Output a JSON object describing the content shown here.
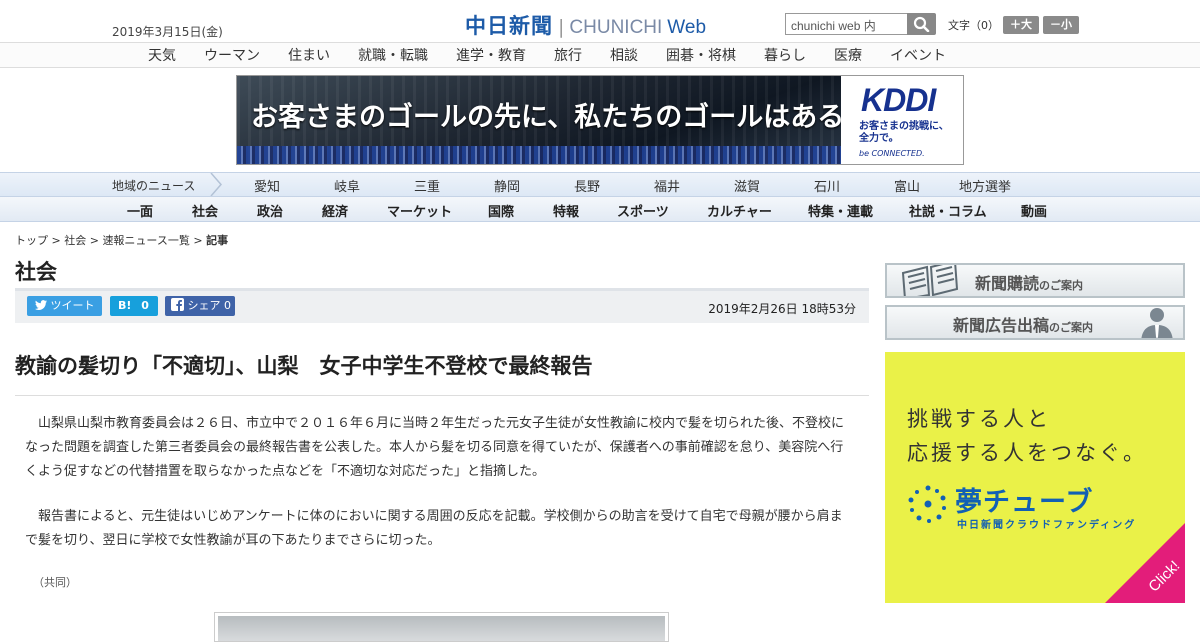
{
  "header": {
    "date": "2019年3月15日(金)",
    "logo_ja": "中日新聞",
    "logo_en": "CHUNICHI",
    "logo_web": "Web",
    "search_placeholder": "chunichi web 内",
    "text_size_label": "文字（0）",
    "text_size_up": "＋大",
    "text_size_down": "－小"
  },
  "topic_nav": [
    "天気",
    "ウーマン",
    "住まい",
    "就職・転職",
    "進学・教育",
    "旅行",
    "相談",
    "囲碁・将棋",
    "暮らし",
    "医療",
    "イベント"
  ],
  "ad": {
    "copy": "お客さまのゴールの先に、私たちのゴールはある。",
    "brand": "KDDI",
    "brand_sub_1": "お客さまの挑戦に、",
    "brand_sub_2": "全力で。",
    "tagline": "be CONNECTED."
  },
  "region_nav": {
    "label": "地域のニュース",
    "items": [
      "愛知",
      "岐阜",
      "三重",
      "静岡",
      "長野",
      "福井",
      "滋賀",
      "石川",
      "富山",
      "地方選挙"
    ]
  },
  "main_nav": [
    "一面",
    "社会",
    "政治",
    "経済",
    "マーケット",
    "国際",
    "特報",
    "スポーツ",
    "カルチャー",
    "特集・連載",
    "社説・コラム",
    "動画"
  ],
  "breadcrumb": {
    "items": [
      "トップ",
      "社会",
      "速報ニュース一覧"
    ],
    "separator": ">",
    "current": "記事"
  },
  "section_title": "社会",
  "share": {
    "tweet_label": "ツイート",
    "hatena_label": "B!",
    "hatena_count": "0",
    "facebook_label": "シェア",
    "facebook_count": "0",
    "published": "2019年2月26日 18時53分"
  },
  "article": {
    "headline": "教諭の髪切り「不適切」、山梨　女子中学生不登校で最終報告",
    "paragraphs": [
      "山梨県山梨市教育委員会は２６日、市立中で２０１６年６月に当時２年生だった元女子生徒が女性教諭に校内で髪を切られた後、不登校になった問題を調査した第三者委員会の最終報告書を公表した。本人から髪を切る同意を得ていたが、保護者への事前確認を怠り、美容院へ行くよう促すなどの代替措置を取らなかった点などを「不適切な対応だった」と指摘した。",
      "報告書によると、元生徒はいじめアンケートに体のにおいに関する周囲の反応を記載。学校側からの助言を受けて自宅で母親が腰から肩まで髪を切り、翌日に学校で女性教諭が耳の下あたりまでさらに切った。"
    ],
    "credit": "（共同）"
  },
  "sidebar": {
    "subscribe_main": "新聞購読",
    "subscribe_sub": "のご案内",
    "ad_main": "新聞広告出稿",
    "ad_sub": "のご案内",
    "yume_line1": "挑戦する人と",
    "yume_line2": "応援する人をつなぐ。",
    "yume_name": "夢チューブ",
    "yume_sub": "中日新聞クラウドファンディング",
    "yume_click": "Click!"
  },
  "colors": {
    "brand_blue": "#1d5ba8",
    "twitter": "#3a9fe3",
    "hatena": "#17a0dc",
    "facebook": "#3f63a8",
    "yume_bg": "#eaf148",
    "yume_accent": "#e31d7a"
  }
}
